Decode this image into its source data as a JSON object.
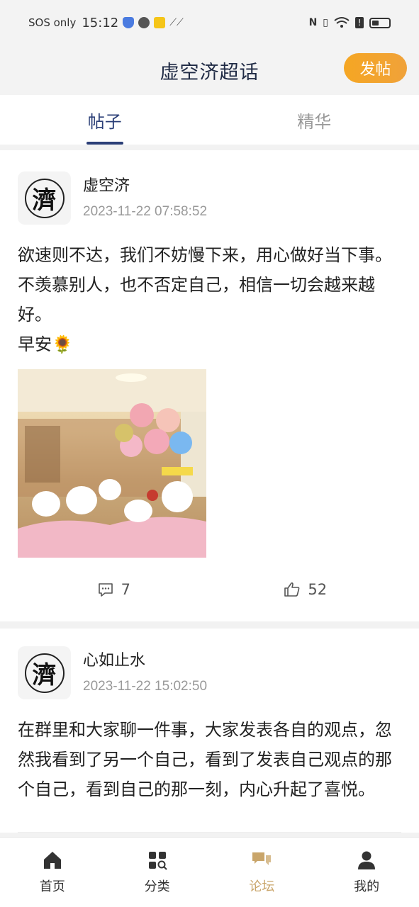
{
  "status_bar": {
    "carrier": "SOS only",
    "time": "15:12"
  },
  "header": {
    "title": "虚空济超话",
    "post_button": "发帖"
  },
  "tabs": [
    {
      "label": "帖子",
      "active": true
    },
    {
      "label": "精华",
      "active": false
    }
  ],
  "posts": [
    {
      "avatar_glyph": "濟",
      "author": "虚空济",
      "time": "2023-11-22 07:58:52",
      "body": "欲速则不达，我们不妨慢下来，用心做好当下事。不羡慕别人，也不否定自己，相信一切会越来越好。\n早安🌻",
      "comments": "7",
      "likes": "52"
    },
    {
      "avatar_glyph": "濟",
      "author": "心如止水",
      "time": "2023-11-22 15:02:50",
      "body": "在群里和大家聊一件事，大家发表各自的观点，忽然我看到了另一个自己，看到了发表自己观点的那个自己，看到自己的那一刻，内心升起了喜悦。"
    }
  ],
  "bottom_nav": [
    {
      "label": "首页",
      "icon": "home-icon"
    },
    {
      "label": "分类",
      "icon": "category-icon"
    },
    {
      "label": "论坛",
      "icon": "forum-icon",
      "active": true
    },
    {
      "label": "我的",
      "icon": "profile-icon"
    }
  ],
  "colors": {
    "accent": "#2b3f77",
    "post_button": "#f5a623",
    "nav_active": "#c9a56a"
  }
}
